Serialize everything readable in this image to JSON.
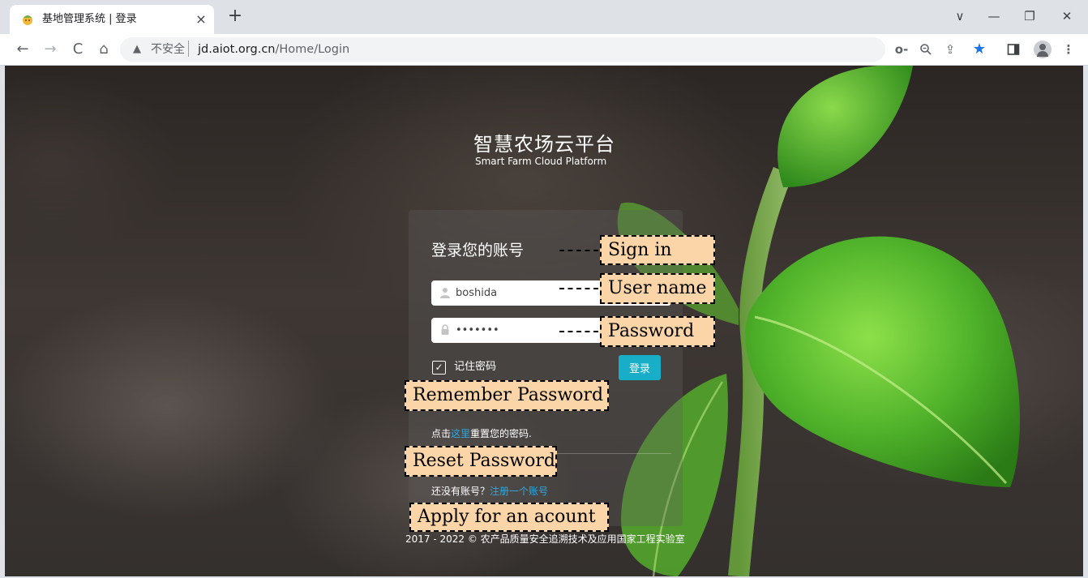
{
  "browser": {
    "tab_title": "基地管理系统 | 登录",
    "tab_close": "×",
    "new_tab": "+",
    "window_controls": {
      "minimize": "—",
      "restore": "❐",
      "close": "✕",
      "tab_search": "∨"
    },
    "nav": {
      "back": "←",
      "forward": "→",
      "reload": "C",
      "home": "⌂"
    },
    "security_label": "不安全",
    "security_icon": "▲",
    "url_host": "jd.aiot.org.cn",
    "url_path": "/Home/Login",
    "toolbar_icons": {
      "password_key": "o-",
      "zoom": "🔍︎",
      "share": "⇪",
      "bookmark_star": "★",
      "side_panel": "▯",
      "menu": "⋮"
    },
    "star_color": "#1a73e8"
  },
  "page": {
    "brand_title": "智慧农场云平台",
    "brand_subtitle": "Smart Farm Cloud Platform",
    "heading": "登录您的账号",
    "username_value": "boshida",
    "password_value": "•••••••",
    "remember_check": "✓",
    "remember_label": "记住密码",
    "login_button": "登录",
    "reset_prefix": "点击",
    "reset_link": "这里",
    "reset_suffix": "重置您的密码.",
    "register_prefix": "还没有账号？",
    "register_link": "注册一个账号",
    "footer": "2017 - 2022 © 农产品质量安全追溯技术及应用国家工程实验室",
    "accent_color": "#19aec8",
    "link_color": "#2fa8e0"
  },
  "annotations": {
    "sign_in": "Sign in",
    "user_name": "User name",
    "password": "Password",
    "remember_password": "Remember Password",
    "reset_password": "Reset Password",
    "apply_account": "Apply for an acount",
    "callout_color": "#fbd5a7"
  }
}
